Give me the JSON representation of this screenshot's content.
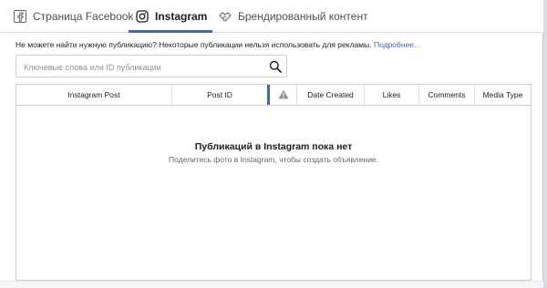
{
  "tabs": [
    {
      "label": "Страница Facebook",
      "icon": "facebook-icon"
    },
    {
      "label": "Instagram",
      "icon": "instagram-icon",
      "active": true
    },
    {
      "label": "Брендированный контент",
      "icon": "handshake-icon"
    }
  ],
  "notice": {
    "text": "Не можете найти нужную публикацию? Некоторые публикации нельзя использовать для рекламы.",
    "link": "Подробнее..."
  },
  "search": {
    "placeholder": "Ключевые слова или ID публикации",
    "value": "",
    "icon": "search-icon"
  },
  "table": {
    "columns": [
      "Instagram Post",
      "Post ID",
      "",
      "Date Created",
      "Likes",
      "Comments",
      "Media Type"
    ],
    "warning_icon": "warning-icon",
    "empty_title": "Публикаций в Instagram пока нет",
    "empty_subtitle": "Поделитесь фото в Instagram, чтобы создать объявление."
  },
  "colors": {
    "accent": "#4267b2",
    "text": "#1c1e21",
    "muted": "#606770",
    "border": "#ccd0d5"
  }
}
